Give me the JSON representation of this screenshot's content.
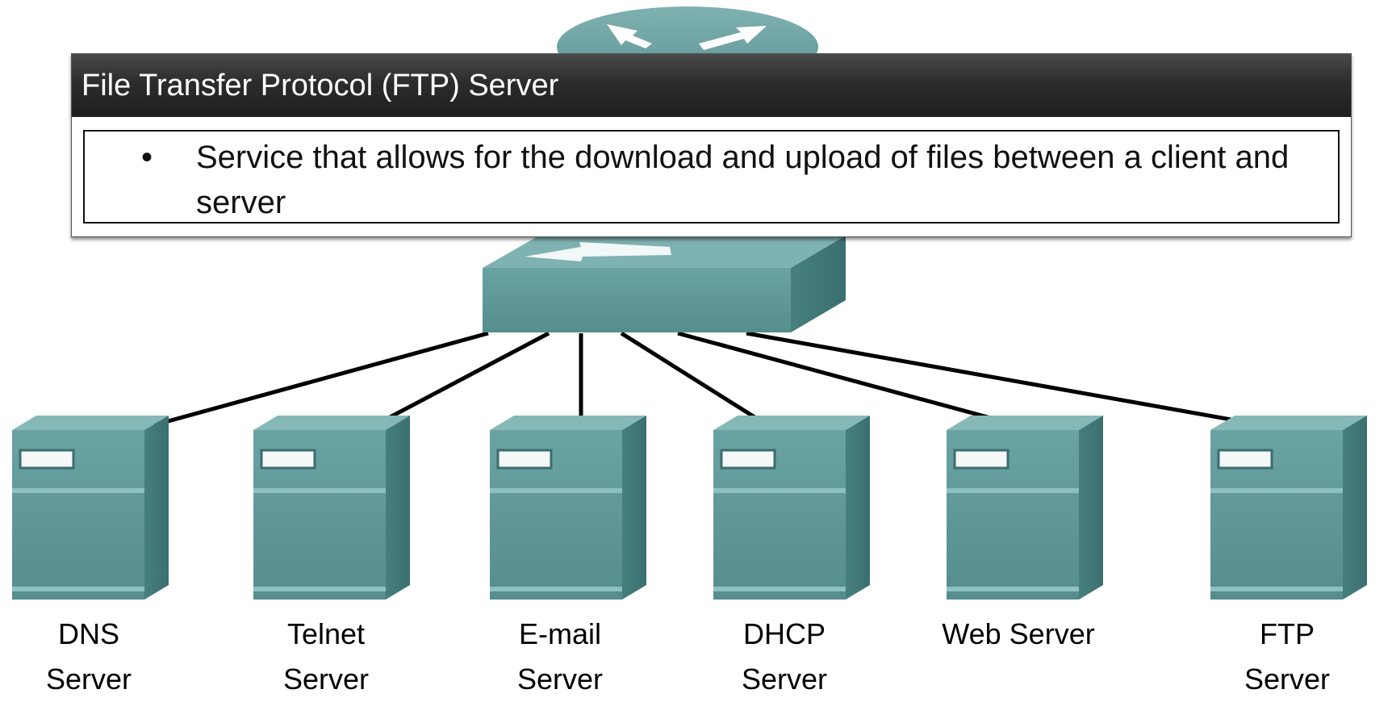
{
  "popup": {
    "title": "File Transfer Protocol (FTP) Server",
    "bullet_symbol": "•",
    "bullet_text": "Service that allows for the download and upload of files between a client and server"
  },
  "servers": [
    {
      "line1": "DNS",
      "line2": "Server"
    },
    {
      "line1": "Telnet",
      "line2": "Server"
    },
    {
      "line1": "E-mail",
      "line2": "Server"
    },
    {
      "line1": "DHCP",
      "line2": "Server"
    },
    {
      "line1": "Web Server",
      "line2": ""
    },
    {
      "line1": "FTP",
      "line2": "Server"
    }
  ],
  "colors": {
    "device_front": "#5f9797",
    "device_side": "#3f7676",
    "device_top": "#86b8b8",
    "header_bg": "#2c2c2c"
  },
  "icons": [
    "router-icon",
    "switch-icon",
    "server-icon"
  ]
}
